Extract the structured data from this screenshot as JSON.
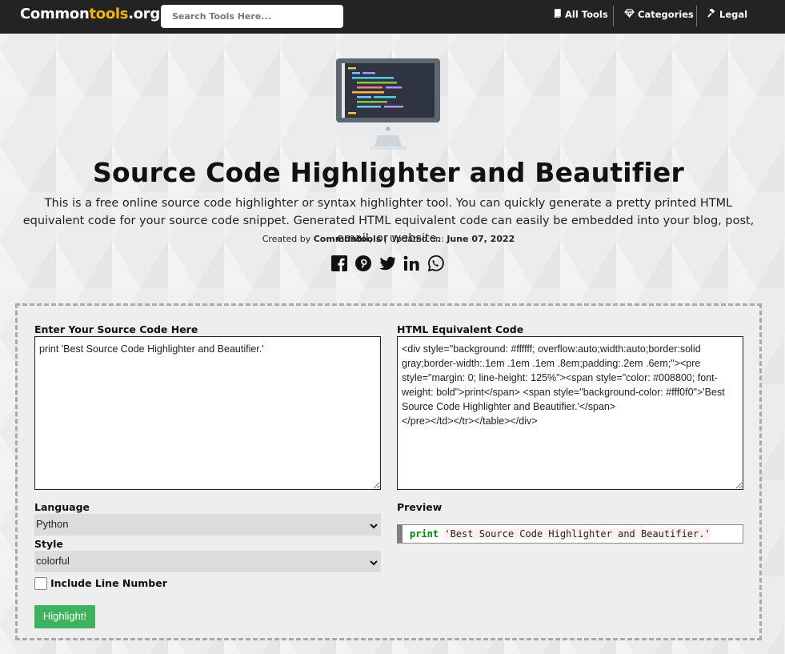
{
  "header": {
    "logo_part1": "Common",
    "logo_part2": "tools",
    "logo_part3": ".org",
    "search_placeholder": "Search Tools Here...",
    "nav": [
      {
        "label": "All Tools",
        "icon": "book-icon"
      },
      {
        "label": "Categories",
        "icon": "diamond-icon"
      },
      {
        "label": "Legal",
        "icon": "gavel-icon"
      }
    ]
  },
  "hero": {
    "title": "Source Code Highlighter and Beautifier",
    "description": "This is a free online source code highlighter or syntax highlighter tool. You can quickly generate a pretty printed HTML equivalent code for your source code snippet. Generated HTML equivalent code can easily be embedded into your blog, post, email, or website.",
    "created_by_prefix": "Created by",
    "author": "Commontools",
    "updated_prefix": "| Updated on:",
    "updated_date": "June 07, 2022",
    "social": [
      "facebook-icon",
      "pinterest-icon",
      "twitter-icon",
      "linkedin-icon",
      "whatsapp-icon"
    ]
  },
  "tool": {
    "source_label": "Enter Your Source Code Here",
    "source_value": "print 'Best Source Code Highlighter and Beautifier.'",
    "html_label": "HTML Equivalent Code",
    "html_value": "<div style=\"background: #ffffff; overflow:auto;width:auto;border:solid gray;border-width:.1em .1em .1em .8em;padding:.2em .6em;\"><pre style=\"margin: 0; line-height: 125%\"><span style=\"color: #008800; font-weight: bold\">print</span> <span style=\"background-color: #fff0f0\">'Best Source Code Highlighter and Beautifier.'</span>\n</pre></td></tr></table></div>",
    "language_label": "Language",
    "language_value": "Python",
    "style_label": "Style",
    "style_value": "colorful",
    "line_number_label": "Include Line Number",
    "line_number_checked": false,
    "highlight_button": "Highlight!",
    "preview_label": "Preview",
    "preview_keyword": "print",
    "preview_string": "'Best Source Code Highlighter and Beautifier.'"
  },
  "colors": {
    "topbar": "#232323",
    "logo_accent": "#f5b400",
    "button": "#3cb35c",
    "keyword": "#008800"
  }
}
